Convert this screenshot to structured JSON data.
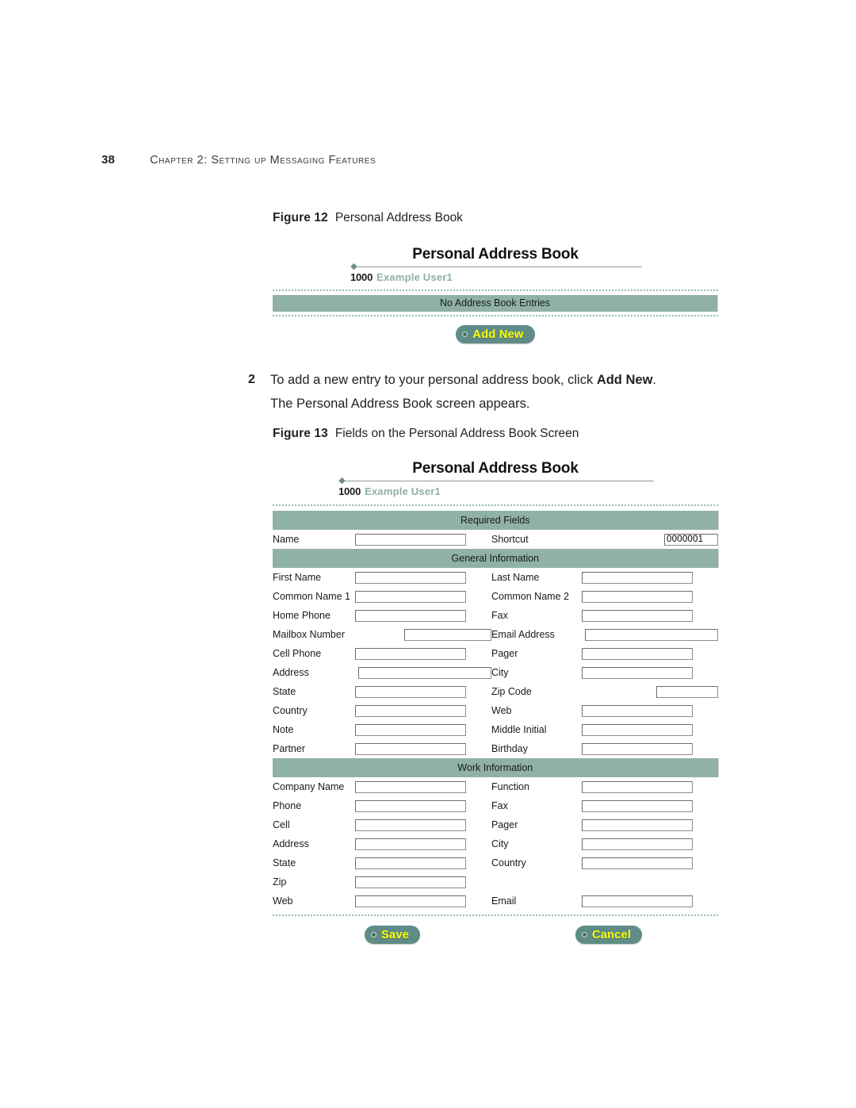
{
  "page": {
    "number": "38",
    "running_head": "Chapter 2: Setting up Messaging Features"
  },
  "figure12": {
    "caption_number": "Figure 12",
    "caption_text": "Personal Address Book",
    "app": {
      "title": "Personal Address Book",
      "user_id": "1000",
      "user_name": "Example User1",
      "empty_message": "No Address Book Entries",
      "add_new_label": "Add New"
    }
  },
  "step": {
    "number": "2",
    "text_before": "To add a new entry to your personal address book, click ",
    "bold_term": "Add New",
    "text_after": ".",
    "line2": "The Personal Address Book screen appears."
  },
  "figure13": {
    "caption_number": "Figure 13",
    "caption_text": "Fields on the Personal Address Book Screen",
    "app": {
      "title": "Personal Address Book",
      "user_id": "1000",
      "user_name": "Example User1",
      "sections": [
        {
          "heading": "Required Fields",
          "rows": [
            {
              "left_label": "Name",
              "left_value": "",
              "left_width": 140,
              "left_align": "left",
              "right_label": "Shortcut",
              "right_value": "0000001",
              "right_width": 68,
              "right_align": "right"
            }
          ]
        },
        {
          "heading": "General Information",
          "rows": [
            {
              "left_label": "First Name",
              "left_value": "",
              "left_width": 140,
              "left_align": "left",
              "right_label": "Last Name",
              "right_value": "",
              "right_width": 140,
              "right_align": "left"
            },
            {
              "left_label": "Common Name 1",
              "left_value": "",
              "left_width": 140,
              "left_align": "left",
              "right_label": "Common Name 2",
              "right_value": "",
              "right_width": 140,
              "right_align": "left"
            },
            {
              "left_label": "Home Phone",
              "left_value": "",
              "left_width": 140,
              "left_align": "left",
              "right_label": "Fax",
              "right_value": "",
              "right_width": 140,
              "right_align": "left"
            },
            {
              "left_label": "Mailbox Number",
              "left_value": "",
              "left_width": 110,
              "left_align": "right",
              "right_label": "Email Address",
              "right_value": "",
              "right_width": 168,
              "right_align": "right"
            },
            {
              "left_label": "Cell Phone",
              "left_value": "",
              "left_width": 140,
              "left_align": "left",
              "right_label": "Pager",
              "right_value": "",
              "right_width": 140,
              "right_align": "left"
            },
            {
              "left_label": "Address",
              "left_value": "",
              "left_width": 168,
              "left_align": "right",
              "right_label": "City",
              "right_value": "",
              "right_width": 140,
              "right_align": "left"
            },
            {
              "left_label": "State",
              "left_value": "",
              "left_width": 140,
              "left_align": "left",
              "right_label": "Zip Code",
              "right_value": "",
              "right_width": 78,
              "right_align": "right"
            },
            {
              "left_label": "Country",
              "left_value": "",
              "left_width": 140,
              "left_align": "left",
              "right_label": "Web",
              "right_value": "",
              "right_width": 140,
              "right_align": "left"
            },
            {
              "left_label": "Note",
              "left_value": "",
              "left_width": 140,
              "left_align": "left",
              "right_label": "Middle Initial",
              "right_value": "",
              "right_width": 140,
              "right_align": "left"
            },
            {
              "left_label": "Partner",
              "left_value": "",
              "left_width": 140,
              "left_align": "left",
              "right_label": "Birthday",
              "right_value": "",
              "right_width": 140,
              "right_align": "left"
            }
          ]
        },
        {
          "heading": "Work Information",
          "rows": [
            {
              "left_label": "Company Name",
              "left_value": "",
              "left_width": 140,
              "left_align": "left",
              "right_label": "Function",
              "right_value": "",
              "right_width": 140,
              "right_align": "left"
            },
            {
              "left_label": "Phone",
              "left_value": "",
              "left_width": 140,
              "left_align": "left",
              "right_label": "Fax",
              "right_value": "",
              "right_width": 140,
              "right_align": "left"
            },
            {
              "left_label": "Cell",
              "left_value": "",
              "left_width": 140,
              "left_align": "left",
              "right_label": "Pager",
              "right_value": "",
              "right_width": 140,
              "right_align": "left"
            },
            {
              "left_label": "Address",
              "left_value": "",
              "left_width": 140,
              "left_align": "left",
              "right_label": "City",
              "right_value": "",
              "right_width": 140,
              "right_align": "left"
            },
            {
              "left_label": "State",
              "left_value": "",
              "left_width": 140,
              "left_align": "left",
              "right_label": "Country",
              "right_value": "",
              "right_width": 140,
              "right_align": "left"
            },
            {
              "left_label": "Zip",
              "left_value": "",
              "left_width": 140,
              "left_align": "left",
              "right_label": "",
              "right_value": null,
              "right_width": 140,
              "right_align": "left"
            },
            {
              "left_label": "Web",
              "left_value": "",
              "left_width": 140,
              "left_align": "left",
              "right_label": "Email",
              "right_value": "",
              "right_width": 140,
              "right_align": "left"
            }
          ]
        }
      ],
      "save_label": "Save",
      "cancel_label": "Cancel"
    }
  },
  "colors": {
    "band_green": "#8fb2a4",
    "button_teal": "#5f8c86",
    "button_text_yellow": "#ffff00",
    "user_name_green": "#8fb0a6",
    "dotted_rule": "#9ab8ae"
  }
}
